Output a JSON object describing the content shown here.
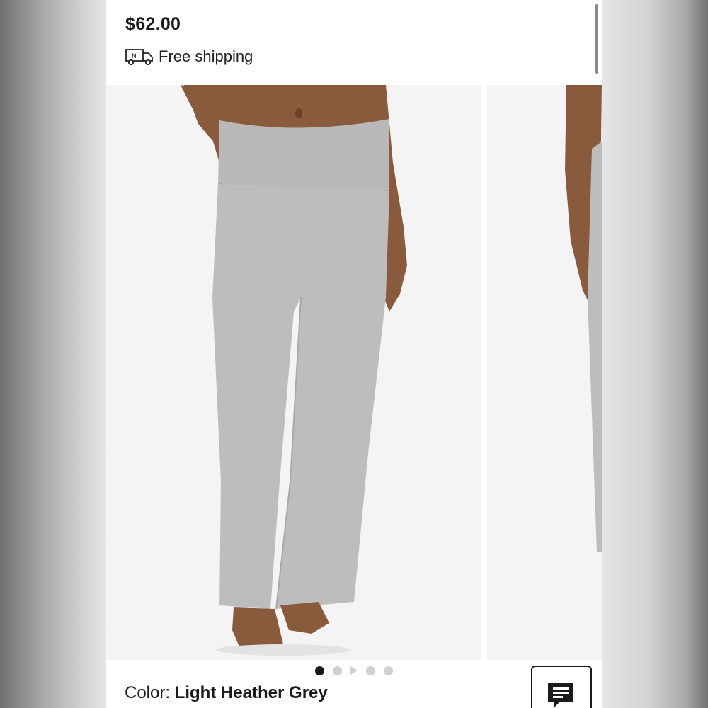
{
  "product": {
    "price": "$62.00",
    "shipping_label": "Free shipping",
    "shipping_icon": "delivery-truck-icon",
    "color_prefix": "Color: ",
    "color_value": "Light Heather Grey"
  },
  "carousel": {
    "dot_count": 5,
    "active_index": 0,
    "video_dot_index": 2,
    "slides": [
      {
        "image": "grey-foldover-flare-pants-front"
      },
      {
        "image": "grey-foldover-flare-pants-side"
      }
    ]
  },
  "chat": {
    "icon": "chat-icon"
  },
  "colors": {
    "pants": "#bdbdbd",
    "skin": "#8a5a3c",
    "slide_bg": "#f4f4f4",
    "text": "#1a1a1a"
  }
}
